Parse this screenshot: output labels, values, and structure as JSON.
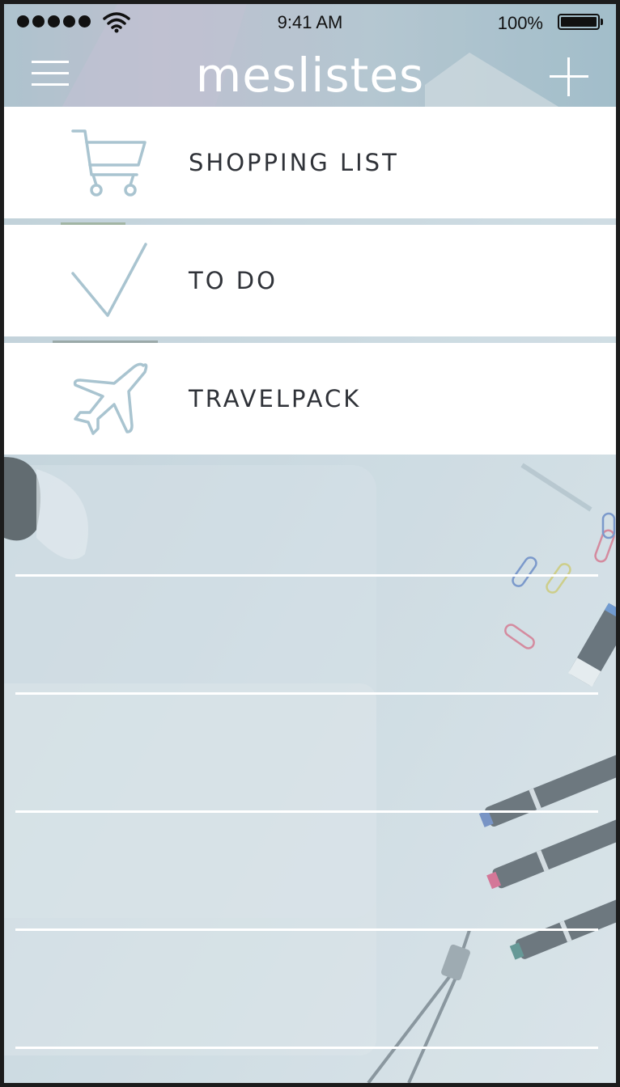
{
  "status_bar": {
    "time": "9:41 AM",
    "battery": "100%"
  },
  "header": {
    "title": "meslistes",
    "menu_icon": "hamburger-icon",
    "add_icon": "plus-icon"
  },
  "lists": [
    {
      "label": "SHOPPING LIST",
      "icon": "shopping-cart-icon"
    },
    {
      "label": "TO DO",
      "icon": "checkmark-icon"
    },
    {
      "label": "TRAVELPACK",
      "icon": "airplane-icon"
    }
  ],
  "colors": {
    "accent_icon": "#a9c4d0",
    "header_text": "#ffffff",
    "label_text": "#2f3238",
    "card_bg": "#ffffff"
  }
}
